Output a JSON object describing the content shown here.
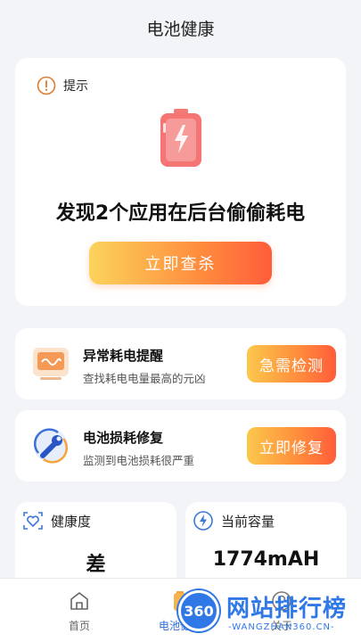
{
  "header": {
    "title": "电池健康"
  },
  "tip_card": {
    "tip_label": "提示",
    "headline": "发现2个应用在后台偷偷耗电",
    "action_label": "立即查杀"
  },
  "features": [
    {
      "title": "异常耗电提醒",
      "subtitle": "查找耗电电量最高的元凶",
      "button": "急需检测"
    },
    {
      "title": "电池损耗修复",
      "subtitle": "监测到电池损耗很严重",
      "button": "立即修复"
    }
  ],
  "stats": [
    {
      "label": "健康度",
      "value": "差"
    },
    {
      "label": "当前容量",
      "value": "1774mAH"
    }
  ],
  "nav": {
    "items": [
      {
        "label": "首页"
      },
      {
        "label": "电池健康"
      },
      {
        "label": "关于"
      }
    ]
  },
  "watermark": {
    "badge": "360",
    "main": "网站排行榜",
    "sub": "-WANGZHAN360.CN-"
  },
  "colors": {
    "accent": "#ff7a3d",
    "nav_active": "#2f6bd8",
    "background": "#f2f4f7"
  }
}
